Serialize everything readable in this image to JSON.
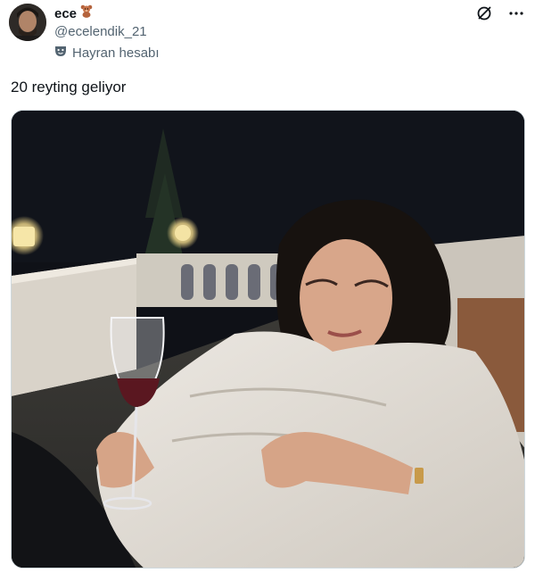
{
  "post": {
    "display_name": "ece",
    "name_emoji_icon": "teddy-bear-icon",
    "handle": "@ecelendik_21",
    "account_label": "Hayran hesabı",
    "account_label_icon": "theater-masks-icon",
    "text": "20 reyting geliyor",
    "media_icon": "scene-still",
    "actions": [
      "grok-icon",
      "more-options-icon"
    ]
  },
  "colors": {
    "text_primary": "#0f1419",
    "text_secondary": "#536471",
    "media_border": "#cfd9de"
  }
}
